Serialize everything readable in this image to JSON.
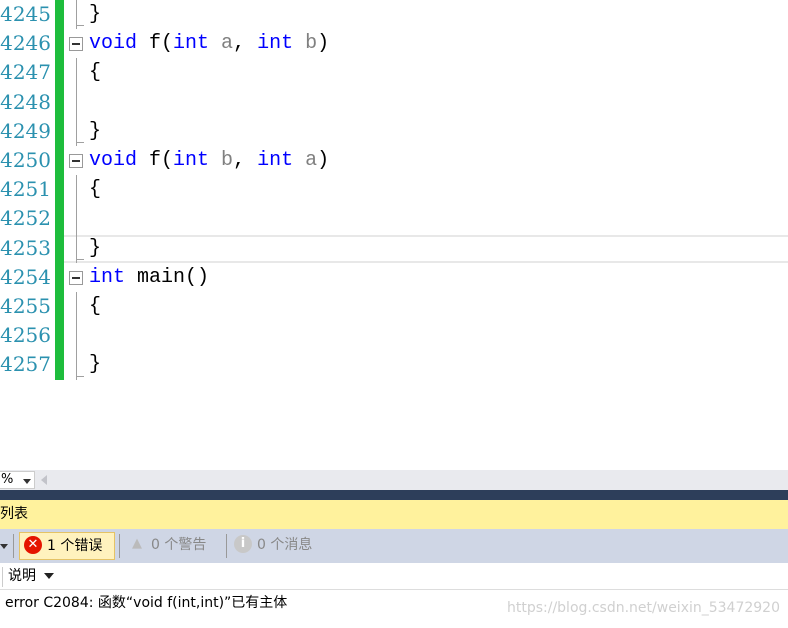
{
  "editor": {
    "current_line": "4253",
    "lines": [
      {
        "num": "4245",
        "tokens": [
          {
            "t": "}",
            "c": "br"
          }
        ],
        "fold": "end"
      },
      {
        "num": "4246",
        "tokens": [
          {
            "t": "void",
            "c": "kw"
          },
          {
            "t": " f(",
            "c": "br"
          },
          {
            "t": "int",
            "c": "kw"
          },
          {
            "t": " a",
            "c": "pm"
          },
          {
            "t": ", ",
            "c": "br"
          },
          {
            "t": "int",
            "c": "kw"
          },
          {
            "t": " b",
            "c": "pm"
          },
          {
            "t": ")",
            "c": "br"
          }
        ],
        "fold": "start"
      },
      {
        "num": "4247",
        "tokens": [
          {
            "t": "{",
            "c": "br"
          }
        ],
        "fold": "mid"
      },
      {
        "num": "4248",
        "tokens": [],
        "fold": "mid"
      },
      {
        "num": "4249",
        "tokens": [
          {
            "t": "}",
            "c": "br"
          }
        ],
        "fold": "end"
      },
      {
        "num": "4250",
        "tokens": [
          {
            "t": "void",
            "c": "kw"
          },
          {
            "t": " f(",
            "c": "br"
          },
          {
            "t": "int",
            "c": "kw"
          },
          {
            "t": " b",
            "c": "pm"
          },
          {
            "t": ", ",
            "c": "br"
          },
          {
            "t": "int",
            "c": "kw"
          },
          {
            "t": " a",
            "c": "pm"
          },
          {
            "t": ")",
            "c": "br"
          }
        ],
        "fold": "start"
      },
      {
        "num": "4251",
        "tokens": [
          {
            "t": "{",
            "c": "br"
          }
        ],
        "fold": "mid"
      },
      {
        "num": "4252",
        "tokens": [],
        "fold": "mid"
      },
      {
        "num": "4253",
        "tokens": [
          {
            "t": "}",
            "c": "br"
          }
        ],
        "fold": "end"
      },
      {
        "num": "4254",
        "tokens": [
          {
            "t": "int",
            "c": "kw"
          },
          {
            "t": " main()",
            "c": "br"
          }
        ],
        "fold": "start"
      },
      {
        "num": "4255",
        "tokens": [
          {
            "t": "{",
            "c": "br"
          }
        ],
        "fold": "mid"
      },
      {
        "num": "4256",
        "tokens": [],
        "fold": "mid"
      },
      {
        "num": "4257",
        "tokens": [
          {
            "t": "}",
            "c": "br"
          }
        ],
        "fold": "end"
      }
    ]
  },
  "zoom": {
    "value": "%"
  },
  "panel": {
    "title": "列表",
    "errors_label": "1 个错误",
    "warnings_label": "0 个警告",
    "messages_label": "0 个消息",
    "column_description": "说明",
    "rows": [
      {
        "description": "error C2084: 函数“void f(int,int)”已有主体"
      }
    ]
  },
  "watermark": "https://blog.csdn.net/weixin_53472920",
  "colors": {
    "line_number": "#2b91af",
    "keyword": "#0000ff",
    "change_bar": "#1ebd3c",
    "panel_header": "#fff29d"
  }
}
